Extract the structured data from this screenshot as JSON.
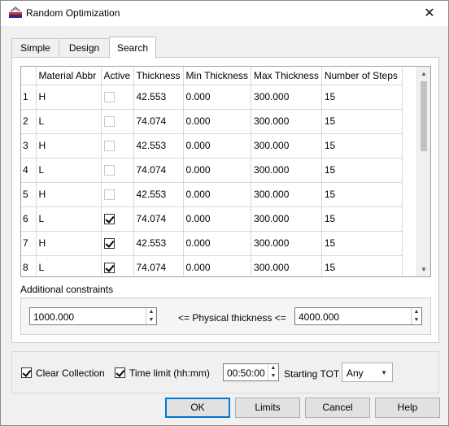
{
  "window": {
    "title": "Random Optimization",
    "close_glyph": "✕"
  },
  "tabs": [
    {
      "label": "Simple",
      "active": false
    },
    {
      "label": "Design",
      "active": false
    },
    {
      "label": "Search",
      "active": true
    }
  ],
  "grid": {
    "columns": [
      "",
      "Material Abbr",
      "Active",
      "Thickness",
      "Min Thickness",
      "Max Thickness",
      "Number of Steps"
    ],
    "rows": [
      {
        "num": "1",
        "material": "H",
        "active": false,
        "active_enabled": false,
        "thickness": "42.553",
        "min": "0.000",
        "max": "300.000",
        "steps": "15"
      },
      {
        "num": "2",
        "material": "L",
        "active": false,
        "active_enabled": false,
        "thickness": "74.074",
        "min": "0.000",
        "max": "300.000",
        "steps": "15"
      },
      {
        "num": "3",
        "material": "H",
        "active": false,
        "active_enabled": false,
        "thickness": "42.553",
        "min": "0.000",
        "max": "300.000",
        "steps": "15"
      },
      {
        "num": "4",
        "material": "L",
        "active": false,
        "active_enabled": false,
        "thickness": "74.074",
        "min": "0.000",
        "max": "300.000",
        "steps": "15"
      },
      {
        "num": "5",
        "material": "H",
        "active": false,
        "active_enabled": false,
        "thickness": "42.553",
        "min": "0.000",
        "max": "300.000",
        "steps": "15"
      },
      {
        "num": "6",
        "material": "L",
        "active": true,
        "active_enabled": true,
        "thickness": "74.074",
        "min": "0.000",
        "max": "300.000",
        "steps": "15"
      },
      {
        "num": "7",
        "material": "H",
        "active": true,
        "active_enabled": true,
        "thickness": "42.553",
        "min": "0.000",
        "max": "300.000",
        "steps": "15"
      },
      {
        "num": "8",
        "material": "L",
        "active": true,
        "active_enabled": true,
        "thickness": "74.074",
        "min": "0.000",
        "max": "300.000",
        "steps": "15"
      }
    ]
  },
  "constraints": {
    "label": "Additional constraints",
    "min_value": "1000.000",
    "relation_label": "<= Physical thickness <=",
    "max_value": "4000.000"
  },
  "options": {
    "clear_collection_label": "Clear Collection",
    "clear_collection_checked": true,
    "time_limit_label": "Time limit (hh:mm)",
    "time_limit_checked": true,
    "time_limit_value": "00:50:00",
    "starting_tot_label": "Starting TOT",
    "starting_tot_value": "Any"
  },
  "buttons": {
    "ok": "OK",
    "limits": "Limits",
    "cancel": "Cancel",
    "help": "Help"
  },
  "icons": {
    "app": "app-icon",
    "close": "close-icon",
    "spin_up": "spin-up-icon",
    "spin_down": "spin-down-icon",
    "dropdown": "chevron-down-icon",
    "scroll_up": "scroll-up-icon",
    "scroll_down": "scroll-down-icon"
  },
  "colors": {
    "accent": "#0078d7",
    "window_bg": "#f0f0f0"
  }
}
